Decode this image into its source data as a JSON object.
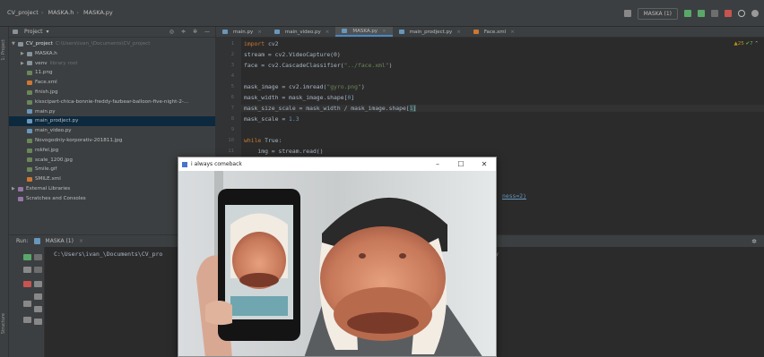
{
  "breadcrumb": {
    "project": "CV_project",
    "folder": "MASKA.h",
    "file": "MASKA.py"
  },
  "toolbar": {
    "run_config": "MASKA (1)"
  },
  "toolstrip": {
    "project_label": "1: Project",
    "structure_label": "Structure"
  },
  "project_panel": {
    "header": "Project",
    "root": {
      "name": "CV_project",
      "path": "C:\\Users\\ivan_\\Documents\\CV_project"
    },
    "items": [
      {
        "name": "MASKA.h",
        "type": "folder",
        "level": 1,
        "expand": "▶"
      },
      {
        "name": "venv",
        "type": "folder",
        "level": 1,
        "expand": "▶",
        "note": "library root"
      },
      {
        "name": "11.png",
        "type": "file",
        "level": 1
      },
      {
        "name": "Face.xml",
        "type": "xml",
        "level": 1
      },
      {
        "name": "finish.jpg",
        "type": "file",
        "level": 1
      },
      {
        "name": "kisscipart-chica-bonnie-freddy-fazbear-balloon-five-night-2-...",
        "type": "file",
        "level": 1
      },
      {
        "name": "main.py",
        "type": "py",
        "level": 1
      },
      {
        "name": "main_prodject.py",
        "type": "py",
        "level": 1,
        "selected": true
      },
      {
        "name": "main_video.py",
        "type": "py",
        "level": 1
      },
      {
        "name": "Novogodniy-korporativ-201811.jpg",
        "type": "file",
        "level": 1
      },
      {
        "name": "rokfel.jpg",
        "type": "file",
        "level": 1
      },
      {
        "name": "scale_1200.jpg",
        "type": "file",
        "level": 1
      },
      {
        "name": "Smile.gif",
        "type": "file",
        "level": 1
      },
      {
        "name": "SMILE.xml",
        "type": "xml",
        "level": 1
      },
      {
        "name": "External Libraries",
        "type": "lib",
        "level": 0,
        "expand": "▶"
      },
      {
        "name": "Scratches and Consoles",
        "type": "lib",
        "level": 0
      }
    ]
  },
  "editor": {
    "tabs": [
      {
        "label": "main.py",
        "active": false
      },
      {
        "label": "main_video.py",
        "active": false
      },
      {
        "label": "MASKA.py",
        "active": true
      },
      {
        "label": "main_prodject.py",
        "active": false
      },
      {
        "label": "Face.xml",
        "active": false
      }
    ],
    "warnings": {
      "warn_count": "▲25",
      "ok_count": "✔7"
    },
    "line_numbers": [
      "1",
      "2",
      "3",
      "4",
      "5",
      "6",
      "7",
      "8",
      "9",
      "10",
      "11"
    ],
    "lines": {
      "l1_kw": "import",
      "l1_rest": " cv2",
      "l2": "stream = cv2.VideoCapture(0)",
      "l3_a": "face = cv2.CascadeClassifier(",
      "l3_str": "\"../face.xml\"",
      "l3_b": ")",
      "l5_a": "mask_image = cv2.imread(",
      "l5_str": "\"gyro.png\"",
      "l5_b": ")",
      "l6_a": "mask_width = mask_image.shape[",
      "l6_num": "0",
      "l6_b": "]",
      "l7_a": "mask_size_scale = mask_width / mask_image.shape[",
      "l7_num": "1",
      "l7_b": "]",
      "l8_a": "mask_scale = ",
      "l8_num": "1.3",
      "l10_kw": "while",
      "l10_rest": " True:",
      "l11": "    img = stream.read()",
      "behind_window_text": "ness=2)"
    }
  },
  "run": {
    "tab_label": "Run:",
    "config": "MASKA (1)",
    "console": "C:\\Users\\ivan_\\Documents\\CV_pro",
    "console_right": "y"
  },
  "video_window": {
    "title": "i always comeback"
  },
  "colors": {
    "accent": "#4a88c7",
    "keyword": "#cc7832",
    "string": "#6a8759",
    "number": "#6897bb"
  }
}
